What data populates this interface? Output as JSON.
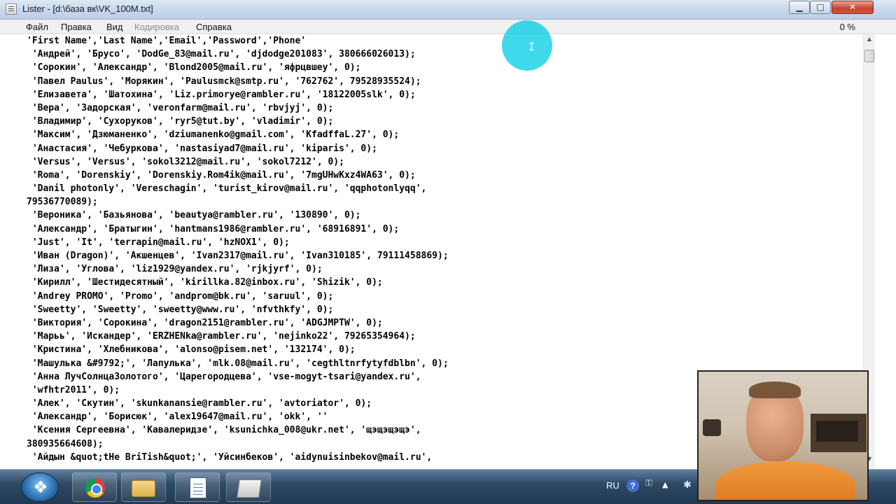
{
  "window": {
    "title": "Lister - [d:\\база вк\\VK_100M.txt]",
    "controls": {
      "minimize": "▁",
      "maximize": "□",
      "close": "✕"
    }
  },
  "menu": {
    "items": [
      "Файл",
      "Правка",
      "Вид",
      "Кодировка",
      "Справка"
    ],
    "disabled": [
      "Кодировка"
    ],
    "percent": "0 %"
  },
  "document": {
    "lines": [
      "'First Name','Last Name','Email','Password','Phone'",
      " 'Андрей', 'Брусо', 'DodGe_83@mail.ru', 'djdodge201083', 380666026013);",
      " 'Сорокин', 'Александр', 'Blond2005@mail.ru', 'яфрцвшеу', 0);",
      " 'Павел Paulus', 'Морякин', 'Paulusmck@smtp.ru', '762762', 79528935524);",
      " 'Елизавета', 'Шатохина', 'Liz.primorye@rambler.ru', '18122005slk', 0);",
      " 'Вера', 'Задорская', 'veronfarm@mail.ru', 'rbvjyj', 0);",
      " 'Владимир', 'Сухоруков', 'ryr5@tut.by', 'vladimir', 0);",
      " 'Максим', 'Дзюманенко', 'dziumanenko@gmail.com', 'KfadffaL.27', 0);",
      " 'Анастасия', 'Чебуркова', 'nastasiyad7@mail.ru', 'kiparis', 0);",
      " 'Versus', 'Versus', 'sokol3212@mail.ru', 'sokol7212', 0);",
      " 'Roma', 'Dorenskiy', 'Dorenskiy.Rom4ik@mail.ru', '7mgUHwKxz4WA63', 0);",
      " 'Danil photonly', 'Vereschagin', 'turist_kirov@mail.ru', 'qqphotonlyqq',",
      "79536770089);",
      " 'Вероника', 'Базьянова', 'beautya@rambler.ru', '130890', 0);",
      " 'Александр', 'Братыгин', 'hantmans1986@rambler.ru', '68916891', 0);",
      " 'Just', 'It', 'terrapin@mail.ru', 'hzNOX1', 0);",
      " 'Иван (Dragon)', 'Акшенцев', 'Ivan2317@mail.ru', 'Ivan310185', 79111458869);",
      " 'Лиза', 'Углова', 'liz1929@yandex.ru', 'rjkjyrf', 0);",
      " 'Кирилл', 'Шестидесятный', 'kirillka.82@inbox.ru', 'Shizik', 0);",
      " 'Andrey PROMO', 'Promo', 'andprom@bk.ru', 'saruul', 0);",
      " 'Sweetty', 'Sweetty', 'sweetty@www.ru', 'nfvthkfy', 0);",
      " 'Виктория', 'Сорокина', 'dragon2151@rambler.ru', 'ADGJMPTW', 0);",
      " 'Марьь', 'Искандер', 'ERZHENka@rambler.ru', 'nejinko22', 79265354964);",
      " 'Кристина', 'Хлебникова', 'alonso@pisem.net', '132174', 0);",
      " 'Машулька &#9792;', 'Лапулька', 'mlk.08@mail.ru', 'cegthltnrfytyfdblbn', 0);",
      " 'Анна ЛучСолнцаЗолотого', 'Царегородцева', 'vse-mogyt-tsari@yandex.ru',",
      " 'wfhtr2011', 0);",
      " 'Алек', 'Скутин', 'skunkanansie@rambler.ru', 'avtoriator', 0);",
      " 'Александр', 'Борисюк', 'alex19647@mail.ru', 'okk', ''",
      " 'Ксения Сергеевна', 'Кавалеридзе', 'ksunichka_008@ukr.net', 'щэщэщэщэ',",
      "380935664608);",
      " 'Айдын &quot;tHe BriTish&quot;', 'Уйсинбеков', 'aidynuisinbekov@mail.ru',"
    ]
  },
  "taskbar": {
    "language": "RU",
    "help_icon_label": "?",
    "key_icon_label": "⚿",
    "arrow_icon_label": "▲",
    "bluetooth_icon_label": "✱"
  },
  "cursor": {
    "symbol": "I"
  },
  "scrollbar": {
    "up": "▲",
    "down": "▼"
  }
}
